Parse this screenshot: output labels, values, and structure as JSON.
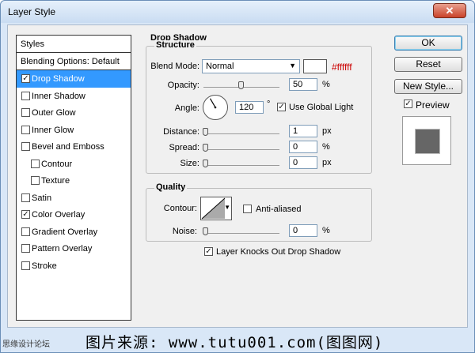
{
  "window": {
    "title": "Layer Style",
    "close_glyph": "✕"
  },
  "styles_list": {
    "header": "Styles",
    "blending_options": "Blending Options: Default",
    "items": [
      {
        "label": "Drop Shadow",
        "checked": true,
        "selected": true,
        "sub": false
      },
      {
        "label": "Inner Shadow",
        "checked": false,
        "selected": false,
        "sub": false
      },
      {
        "label": "Outer Glow",
        "checked": false,
        "selected": false,
        "sub": false
      },
      {
        "label": "Inner Glow",
        "checked": false,
        "selected": false,
        "sub": false
      },
      {
        "label": "Bevel and Emboss",
        "checked": false,
        "selected": false,
        "sub": false
      },
      {
        "label": "Contour",
        "checked": false,
        "selected": false,
        "sub": true
      },
      {
        "label": "Texture",
        "checked": false,
        "selected": false,
        "sub": true
      },
      {
        "label": "Satin",
        "checked": false,
        "selected": false,
        "sub": false
      },
      {
        "label": "Color Overlay",
        "checked": true,
        "selected": false,
        "sub": false
      },
      {
        "label": "Gradient Overlay",
        "checked": false,
        "selected": false,
        "sub": false
      },
      {
        "label": "Pattern Overlay",
        "checked": false,
        "selected": false,
        "sub": false
      },
      {
        "label": "Stroke",
        "checked": false,
        "selected": false,
        "sub": false
      }
    ]
  },
  "drop_shadow": {
    "section_title": "Drop Shadow",
    "structure": {
      "title": "Structure",
      "blend_mode_label": "Blend Mode:",
      "blend_mode_value": "Normal",
      "color_hex_text": "#ffffff",
      "color_swatch": "#ffffff",
      "hex_text_color": "#cc0000",
      "opacity_label": "Opacity:",
      "opacity_value": "50",
      "opacity_unit": "%",
      "opacity_level": 0.5,
      "angle_label": "Angle:",
      "angle_value": "120",
      "angle_unit": "°",
      "use_global_light_label": "Use Global Light",
      "use_global_light_checked": true,
      "distance_label": "Distance:",
      "distance_value": "1",
      "distance_unit": "px",
      "spread_label": "Spread:",
      "spread_value": "0",
      "spread_unit": "%",
      "size_label": "Size:",
      "size_value": "0",
      "size_unit": "px"
    },
    "quality": {
      "title": "Quality",
      "contour_label": "Contour:",
      "anti_aliased_label": "Anti-aliased",
      "anti_aliased_checked": false,
      "noise_label": "Noise:",
      "noise_value": "0",
      "noise_unit": "%"
    },
    "layer_knocks_out_label": "Layer Knocks Out Drop Shadow",
    "layer_knocks_out_checked": true
  },
  "buttons": {
    "ok": "OK",
    "reset": "Reset",
    "new_style": "New Style..."
  },
  "preview": {
    "label": "Preview",
    "checked": true,
    "swatch_color": "#666666"
  },
  "watermark": {
    "left_text": "思缘设计论坛",
    "caption": "图片来源: www.tutu001.com(图图网)"
  }
}
